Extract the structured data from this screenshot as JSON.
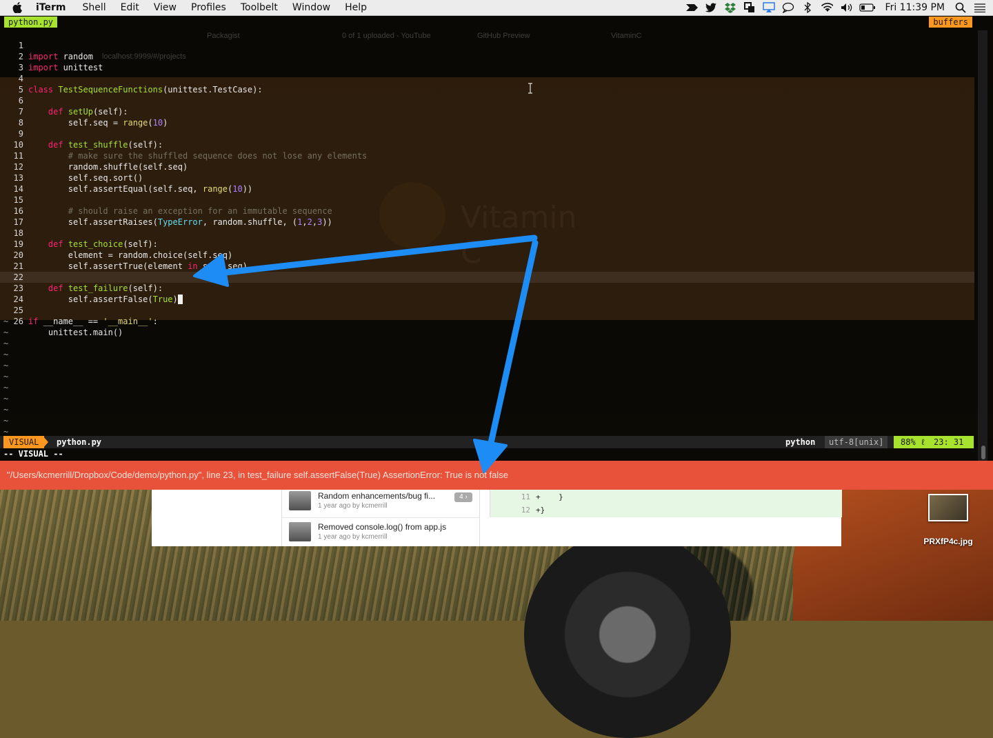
{
  "menubar": {
    "app": "iTerm",
    "items": [
      "Shell",
      "Edit",
      "View",
      "Profiles",
      "Toolbelt",
      "Window",
      "Help"
    ],
    "clock": "Fri 11:39 PM",
    "status_icons": [
      "forward-icon",
      "twitter-icon",
      "dropbox-icon",
      "copy-icon",
      "airplay-icon",
      "chat-icon",
      "bluetooth-icon",
      "wifi-icon",
      "volume-icon",
      "battery-icon",
      "search-icon",
      "list-icon"
    ]
  },
  "ghost_browser": {
    "tabs": [
      "Packagist",
      "0 of 1 uploaded - YouTube",
      "GitHub Preview",
      "VitaminC"
    ],
    "address": "localhost:9999/#/projects",
    "watermark": "Vitamin C"
  },
  "vim": {
    "tab_active": "python.py",
    "tab_buffers": "buffers",
    "lines": [
      {
        "n": "1"
      },
      {
        "n": "2"
      },
      {
        "n": "3"
      },
      {
        "n": "4"
      },
      {
        "n": "5"
      },
      {
        "n": "6"
      },
      {
        "n": "7"
      },
      {
        "n": "8"
      },
      {
        "n": "9"
      },
      {
        "n": "10"
      },
      {
        "n": "11"
      },
      {
        "n": "12"
      },
      {
        "n": "13"
      },
      {
        "n": "14"
      },
      {
        "n": "15"
      },
      {
        "n": "16"
      },
      {
        "n": "17"
      },
      {
        "n": "18"
      },
      {
        "n": "19"
      },
      {
        "n": "20"
      },
      {
        "n": "21"
      },
      {
        "n": "22"
      },
      {
        "n": "23"
      },
      {
        "n": "24"
      },
      {
        "n": "25"
      },
      {
        "n": "26"
      }
    ],
    "code": {
      "l1": [
        "import",
        " random"
      ],
      "l2": [
        "import",
        " unittest"
      ],
      "l4": [
        "class",
        " ",
        "TestSequenceFunctions",
        "(unittest.TestCase):"
      ],
      "l6": [
        "def",
        " ",
        "setUp",
        "(self):"
      ],
      "l7": [
        "self.seq = ",
        "range",
        "(",
        "10",
        ")"
      ],
      "l9": [
        "def",
        " ",
        "test_shuffle",
        "(self):"
      ],
      "l10": "# make sure the shuffled sequence does not lose any elements",
      "l11": "random.shuffle(self.seq)",
      "l12": "self.seq.sort()",
      "l13": [
        "self.assertEqual(self.seq, ",
        "range",
        "(",
        "10",
        "))"
      ],
      "l15": "# should raise an exception for an immutable sequence",
      "l16": [
        "self.assertRaises(",
        "TypeError",
        ", random.shuffle, (",
        "1",
        ",",
        "2",
        ",",
        "3",
        "))"
      ],
      "l18": [
        "def",
        " ",
        "test_choice",
        "(self):"
      ],
      "l19": "element = random.choice(self.seq)",
      "l20": [
        "self.assertTrue(element ",
        "in",
        " self.seq)"
      ],
      "l22": [
        "def",
        " ",
        "test_failure",
        "(self):"
      ],
      "l23": [
        "self.assertFalse(",
        "True",
        ")"
      ],
      "l25": [
        "if",
        " __name__ == ",
        "'__main__'",
        ":"
      ],
      "l26": "unittest.main()"
    },
    "tilde": "~",
    "status": {
      "mode": "VISUAL",
      "file": "python.py",
      "filetype": "python",
      "encoding": "utf-8[unix]",
      "percent": "88% ℓ",
      "position": "23: 31"
    },
    "cmdline": "-- VISUAL --"
  },
  "banner": {
    "message": "\"/Users/kcmerrill/Dropbox/Code/demo/python.py\", line 23, in test_failure self.assertFalse(True) AssertionError: True is not false"
  },
  "github_bg": {
    "commits": [
      {
        "message": "Random enhancements/bug fi...",
        "meta": "1 year ago by kcmerrill",
        "count": "4 ›"
      },
      {
        "message": "Removed console.log() from app.js",
        "meta": "1 year ago by kcmerrill"
      }
    ],
    "diff": [
      {
        "ln": "11",
        "code": "+    }"
      },
      {
        "ln": "12",
        "code": "+}"
      }
    ]
  },
  "desktop": {
    "file_name": "PRXfP4c.jpg"
  },
  "colors": {
    "banner": "#e8523a",
    "vim_green": "#a6e22e",
    "vim_orange": "#fd971f",
    "arrow": "#1e8cf5"
  }
}
